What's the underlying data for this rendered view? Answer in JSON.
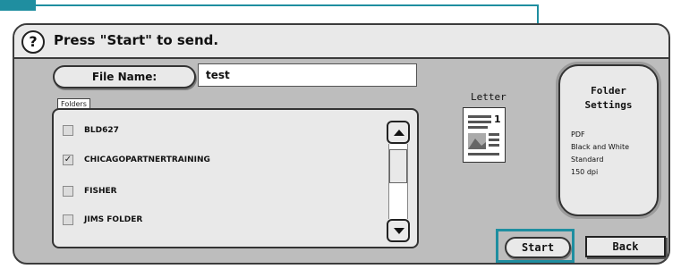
{
  "header": {
    "help_glyph": "?",
    "instruction": "Press \"Start\" to send."
  },
  "file_name": {
    "button_label": "File Name:",
    "value": "test"
  },
  "folders": {
    "label": "Folders",
    "items": [
      {
        "name": "BLD627",
        "checked": false
      },
      {
        "name": "CHICAGOPARTNERTRAINING",
        "checked": true
      },
      {
        "name": "FISHER",
        "checked": false
      },
      {
        "name": "JIMS FOLDER",
        "checked": false
      }
    ]
  },
  "paper": {
    "label": "Letter",
    "page_number": "1"
  },
  "settings": {
    "title": "Folder\nSettings",
    "lines": [
      "PDF",
      "Black and White",
      "Standard",
      "150 dpi"
    ]
  },
  "actions": {
    "start_label": "Start",
    "back_label": "Back"
  },
  "colors": {
    "callout": "#1f8ea0",
    "panel": "#bdbdbd",
    "surface": "#e9e9e9"
  }
}
